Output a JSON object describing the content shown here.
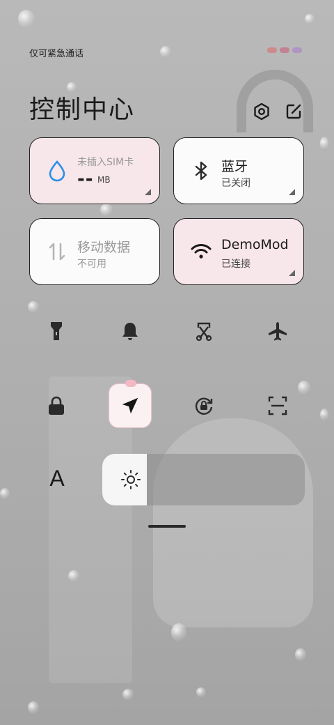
{
  "status_bar": {
    "text": "仅可紧急通话"
  },
  "header": {
    "title": "控制中心",
    "settings_icon": "settings-hexagon-icon",
    "edit_icon": "edit-icon"
  },
  "tiles": {
    "data": {
      "label": "未插入SIM卡",
      "value": "--",
      "unit": "MB",
      "icon": "water-drop-icon"
    },
    "bluetooth": {
      "label": "蓝牙",
      "status": "已关闭",
      "icon": "bluetooth-icon"
    },
    "mobile_data": {
      "label": "移动数据",
      "status": "不可用",
      "icon": "data-arrows-icon"
    },
    "wifi": {
      "label": "DemoMod",
      "status": "已连接",
      "icon": "wifi-icon"
    }
  },
  "quick_toggles": [
    {
      "name": "flashlight",
      "icon": "flashlight-icon"
    },
    {
      "name": "mute",
      "icon": "bell-icon"
    },
    {
      "name": "screenshot",
      "icon": "screenshot-scissors-icon"
    },
    {
      "name": "airplane",
      "icon": "airplane-icon"
    },
    {
      "name": "lock",
      "icon": "lock-icon"
    },
    {
      "name": "location",
      "icon": "location-arrow-icon"
    },
    {
      "name": "rotation-lock",
      "icon": "rotation-lock-icon"
    },
    {
      "name": "scan",
      "icon": "scan-icon"
    }
  ],
  "font_toggle": {
    "label": "A"
  },
  "brightness": {
    "level": 0.22,
    "icon": "sun-icon"
  },
  "colors": {
    "accent_blue": "#2b8fe8",
    "tile_pink": "#f7e6ea",
    "tile_white": "#ffffff"
  }
}
